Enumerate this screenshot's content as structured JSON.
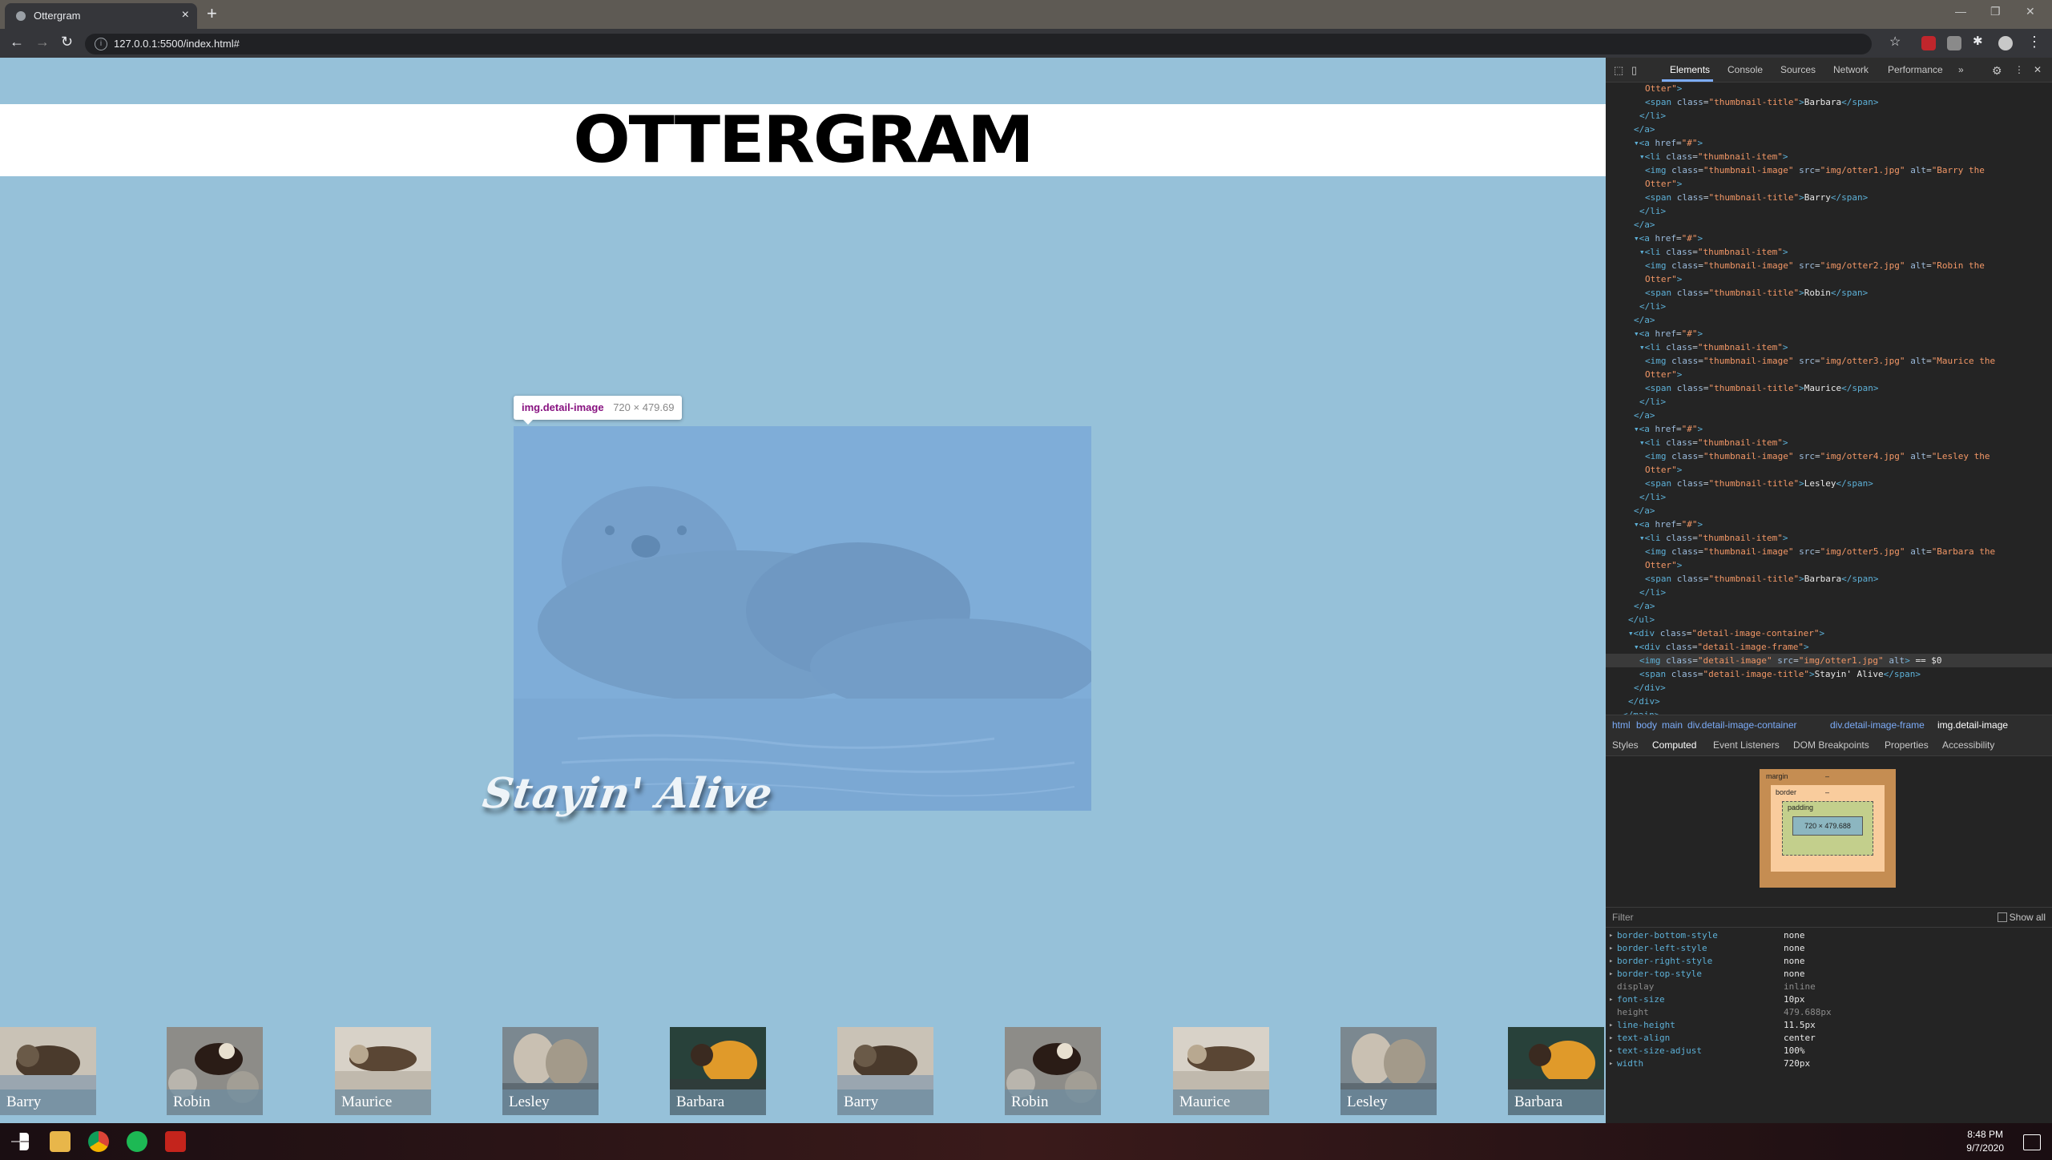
{
  "browser": {
    "tab_title": "Ottergram",
    "tab_close": "×",
    "new_tab": "+",
    "url": "127.0.0.1:5500/index.html#",
    "window_controls": [
      "—",
      "❐",
      "✕"
    ]
  },
  "page": {
    "logo": "OTTERGRAM",
    "detail_title": "Stayin' Alive",
    "tooltip": {
      "name": "img.detail-image",
      "size": "720 × 479.69"
    },
    "thumbnails": [
      "Barry",
      "Robin",
      "Maurice",
      "Lesley",
      "Barbara",
      "Barry",
      "Robin",
      "Maurice",
      "Lesley",
      "Barbara"
    ]
  },
  "devtools": {
    "tabs": [
      "Elements",
      "Console",
      "Sources",
      "Network",
      "Performance"
    ],
    "more": "»",
    "dom_lines": [
      {
        "indent": 7,
        "html": "<span class='attrv'>Otter\"</span><span class='tagc'>&gt;</span>"
      },
      {
        "indent": 7,
        "html": "<span class='tagc'>&lt;span</span> <span class='attrn'>class</span>=<span class='attrv'>\"thumbnail-title\"</span><span class='tagc'>&gt;</span><span class='txt'>Barbara</span><span class='tagc'>&lt;/span&gt;</span>"
      },
      {
        "indent": 6,
        "html": "<span class='tagc'>&lt;/li&gt;</span>"
      },
      {
        "indent": 5,
        "html": "<span class='tagc'>&lt;/a&gt;</span>"
      },
      {
        "indent": 5,
        "html": "<span class='tagc'>▾&lt;a</span> <span class='attrn'>href</span>=<span class='attrv'>\"#\"</span><span class='tagc'>&gt;</span>"
      },
      {
        "indent": 6,
        "html": "<span class='tagc'>▾&lt;li</span> <span class='attrn'>class</span>=<span class='attrv'>\"thumbnail-item\"</span><span class='tagc'>&gt;</span>"
      },
      {
        "indent": 7,
        "html": "<span class='tagc'>&lt;img</span> <span class='attrn'>class</span>=<span class='attrv'>\"thumbnail-image\"</span> <span class='attrn'>src</span>=<span class='attrv'>\"img/otter1.jpg\"</span> <span class='attrn'>alt</span>=<span class='attrv'>\"Barry the</span>"
      },
      {
        "indent": 7,
        "html": "<span class='attrv'>Otter\"</span><span class='tagc'>&gt;</span>"
      },
      {
        "indent": 7,
        "html": "<span class='tagc'>&lt;span</span> <span class='attrn'>class</span>=<span class='attrv'>\"thumbnail-title\"</span><span class='tagc'>&gt;</span><span class='txt'>Barry</span><span class='tagc'>&lt;/span&gt;</span>"
      },
      {
        "indent": 6,
        "html": "<span class='tagc'>&lt;/li&gt;</span>"
      },
      {
        "indent": 5,
        "html": "<span class='tagc'>&lt;/a&gt;</span>"
      },
      {
        "indent": 5,
        "html": "<span class='tagc'>▾&lt;a</span> <span class='attrn'>href</span>=<span class='attrv'>\"#\"</span><span class='tagc'>&gt;</span>"
      },
      {
        "indent": 6,
        "html": "<span class='tagc'>▾&lt;li</span> <span class='attrn'>class</span>=<span class='attrv'>\"thumbnail-item\"</span><span class='tagc'>&gt;</span>"
      },
      {
        "indent": 7,
        "html": "<span class='tagc'>&lt;img</span> <span class='attrn'>class</span>=<span class='attrv'>\"thumbnail-image\"</span> <span class='attrn'>src</span>=<span class='attrv'>\"img/otter2.jpg\"</span> <span class='attrn'>alt</span>=<span class='attrv'>\"Robin the</span>"
      },
      {
        "indent": 7,
        "html": "<span class='attrv'>Otter\"</span><span class='tagc'>&gt;</span>"
      },
      {
        "indent": 7,
        "html": "<span class='tagc'>&lt;span</span> <span class='attrn'>class</span>=<span class='attrv'>\"thumbnail-title\"</span><span class='tagc'>&gt;</span><span class='txt'>Robin</span><span class='tagc'>&lt;/span&gt;</span>"
      },
      {
        "indent": 6,
        "html": "<span class='tagc'>&lt;/li&gt;</span>"
      },
      {
        "indent": 5,
        "html": "<span class='tagc'>&lt;/a&gt;</span>"
      },
      {
        "indent": 5,
        "html": "<span class='tagc'>▾&lt;a</span> <span class='attrn'>href</span>=<span class='attrv'>\"#\"</span><span class='tagc'>&gt;</span>"
      },
      {
        "indent": 6,
        "html": "<span class='tagc'>▾&lt;li</span> <span class='attrn'>class</span>=<span class='attrv'>\"thumbnail-item\"</span><span class='tagc'>&gt;</span>"
      },
      {
        "indent": 7,
        "html": "<span class='tagc'>&lt;img</span> <span class='attrn'>class</span>=<span class='attrv'>\"thumbnail-image\"</span> <span class='attrn'>src</span>=<span class='attrv'>\"img/otter3.jpg\"</span> <span class='attrn'>alt</span>=<span class='attrv'>\"Maurice the</span>"
      },
      {
        "indent": 7,
        "html": "<span class='attrv'>Otter\"</span><span class='tagc'>&gt;</span>"
      },
      {
        "indent": 7,
        "html": "<span class='tagc'>&lt;span</span> <span class='attrn'>class</span>=<span class='attrv'>\"thumbnail-title\"</span><span class='tagc'>&gt;</span><span class='txt'>Maurice</span><span class='tagc'>&lt;/span&gt;</span>"
      },
      {
        "indent": 6,
        "html": "<span class='tagc'>&lt;/li&gt;</span>"
      },
      {
        "indent": 5,
        "html": "<span class='tagc'>&lt;/a&gt;</span>"
      },
      {
        "indent": 5,
        "html": "<span class='tagc'>▾&lt;a</span> <span class='attrn'>href</span>=<span class='attrv'>\"#\"</span><span class='tagc'>&gt;</span>"
      },
      {
        "indent": 6,
        "html": "<span class='tagc'>▾&lt;li</span> <span class='attrn'>class</span>=<span class='attrv'>\"thumbnail-item\"</span><span class='tagc'>&gt;</span>"
      },
      {
        "indent": 7,
        "html": "<span class='tagc'>&lt;img</span> <span class='attrn'>class</span>=<span class='attrv'>\"thumbnail-image\"</span> <span class='attrn'>src</span>=<span class='attrv'>\"img/otter4.jpg\"</span> <span class='attrn'>alt</span>=<span class='attrv'>\"Lesley the</span>"
      },
      {
        "indent": 7,
        "html": "<span class='attrv'>Otter\"</span><span class='tagc'>&gt;</span>"
      },
      {
        "indent": 7,
        "html": "<span class='tagc'>&lt;span</span> <span class='attrn'>class</span>=<span class='attrv'>\"thumbnail-title\"</span><span class='tagc'>&gt;</span><span class='txt'>Lesley</span><span class='tagc'>&lt;/span&gt;</span>"
      },
      {
        "indent": 6,
        "html": "<span class='tagc'>&lt;/li&gt;</span>"
      },
      {
        "indent": 5,
        "html": "<span class='tagc'>&lt;/a&gt;</span>"
      },
      {
        "indent": 5,
        "html": "<span class='tagc'>▾&lt;a</span> <span class='attrn'>href</span>=<span class='attrv'>\"#\"</span><span class='tagc'>&gt;</span>"
      },
      {
        "indent": 6,
        "html": "<span class='tagc'>▾&lt;li</span> <span class='attrn'>class</span>=<span class='attrv'>\"thumbnail-item\"</span><span class='tagc'>&gt;</span>"
      },
      {
        "indent": 7,
        "html": "<span class='tagc'>&lt;img</span> <span class='attrn'>class</span>=<span class='attrv'>\"thumbnail-image\"</span> <span class='attrn'>src</span>=<span class='attrv'>\"img/otter5.jpg\"</span> <span class='attrn'>alt</span>=<span class='attrv'>\"Barbara the</span>"
      },
      {
        "indent": 7,
        "html": "<span class='attrv'>Otter\"</span><span class='tagc'>&gt;</span>"
      },
      {
        "indent": 7,
        "html": "<span class='tagc'>&lt;span</span> <span class='attrn'>class</span>=<span class='attrv'>\"thumbnail-title\"</span><span class='tagc'>&gt;</span><span class='txt'>Barbara</span><span class='tagc'>&lt;/span&gt;</span>"
      },
      {
        "indent": 6,
        "html": "<span class='tagc'>&lt;/li&gt;</span>"
      },
      {
        "indent": 5,
        "html": "<span class='tagc'>&lt;/a&gt;</span>"
      },
      {
        "indent": 4,
        "html": "<span class='tagc'>&lt;/ul&gt;</span>"
      },
      {
        "indent": 4,
        "html": "<span class='tagc'>▾&lt;div</span> <span class='attrn'>class</span>=<span class='attrv'>\"detail-image-container\"</span><span class='tagc'>&gt;</span>"
      },
      {
        "indent": 5,
        "html": "<span class='tagc'>▾&lt;div</span> <span class='attrn'>class</span>=<span class='attrv'>\"detail-image-frame\"</span><span class='tagc'>&gt;</span>"
      },
      {
        "indent": 6,
        "sel": true,
        "html": "<span class='tagc'>&lt;img</span> <span class='attrn'>class</span>=<span class='attrv'>\"detail-image\"</span> <span class='attrn'>src</span>=<span class='attrv'>\"img/otter1.jpg\"</span> <span class='attrn'>alt</span><span class='tagc'>&gt;</span> <span class='txt'>== $0</span>"
      },
      {
        "indent": 6,
        "html": "<span class='tagc'>&lt;span</span> <span class='attrn'>class</span>=<span class='attrv'>\"detail-image-title\"</span><span class='tagc'>&gt;</span><span class='txt'>Stayin' Alive</span><span class='tagc'>&lt;/span&gt;</span>"
      },
      {
        "indent": 5,
        "html": "<span class='tagc'>&lt;/div&gt;</span>"
      },
      {
        "indent": 4,
        "html": "<span class='tagc'>&lt;/div&gt;</span>"
      },
      {
        "indent": 3,
        "html": "<span class='tagc'>&lt;/main&gt;</span>"
      }
    ],
    "breadcrumbs": [
      "html",
      "body",
      "main",
      "div.detail-image-container",
      "div.detail-image-frame",
      "img.detail-image"
    ],
    "subtabs": [
      "Styles",
      "Computed",
      "Event Listeners",
      "DOM Breakpoints",
      "Properties",
      "Accessibility"
    ],
    "box_model": {
      "margin": "margin",
      "border": "border",
      "padding": "padding",
      "content": "720 × 479.688",
      "dash": "–"
    },
    "filter_placeholder": "Filter",
    "show_all": "Show all",
    "computed": [
      {
        "name": "border-bottom-style",
        "value": "none",
        "dim": false
      },
      {
        "name": "border-left-style",
        "value": "none",
        "dim": false
      },
      {
        "name": "border-right-style",
        "value": "none",
        "dim": false
      },
      {
        "name": "border-top-style",
        "value": "none",
        "dim": false
      },
      {
        "name": "display",
        "value": "inline",
        "dim": true
      },
      {
        "name": "font-size",
        "value": "10px",
        "dim": false
      },
      {
        "name": "height",
        "value": "479.688px",
        "dim": true
      },
      {
        "name": "line-height",
        "value": "11.5px",
        "dim": false
      },
      {
        "name": "text-align",
        "value": "center",
        "dim": false
      },
      {
        "name": "text-size-adjust",
        "value": "100%",
        "dim": false
      },
      {
        "name": "width",
        "value": "720px",
        "dim": false
      }
    ]
  },
  "taskbar": {
    "time": "8:48 PM",
    "date": "9/7/2020"
  }
}
